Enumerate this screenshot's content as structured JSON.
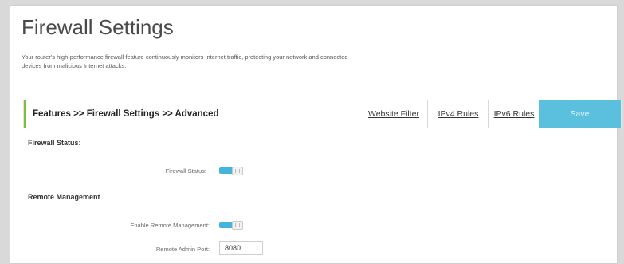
{
  "page": {
    "title": "Firewall Settings",
    "description": "Your router's high-performance firewall feature continuously monitors Internet traffic, protecting your network and connected devices from malicious Internet attacks."
  },
  "toolbar": {
    "breadcrumb": "Features >> Firewall Settings >> Advanced",
    "tabs": [
      {
        "label": "Website Filter"
      },
      {
        "label": "IPv4 Rules"
      },
      {
        "label": "IPv6 Rules"
      }
    ],
    "save_label": "Save"
  },
  "firewall_status_section": {
    "heading": "Firewall Status:",
    "firewall_status": {
      "label": "Firewall Status:",
      "enabled": true
    }
  },
  "remote_management_section": {
    "heading": "Remote Management",
    "enable_remote_management": {
      "label": "Enable Remote Management:",
      "enabled": true
    },
    "remote_admin_port": {
      "label": "Remote Admin Port:",
      "value": "8080"
    }
  },
  "colors": {
    "accent": "#5bc0de",
    "toggle_on": "#45b4dc",
    "breadcrumb_accent": "#7cbf3a"
  }
}
